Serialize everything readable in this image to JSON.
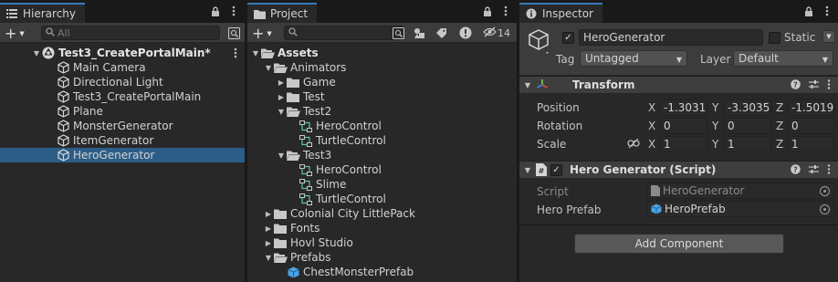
{
  "hierarchy": {
    "tab_label": "Hierarchy",
    "search_placeholder": "All",
    "scene_name": "Test3_CreatePortalMain*",
    "items": [
      {
        "label": "Main Camera"
      },
      {
        "label": "Directional Light"
      },
      {
        "label": "Test3_CreatePortalMain"
      },
      {
        "label": "Plane"
      },
      {
        "label": "MonsterGenerator"
      },
      {
        "label": "ItemGenerator"
      },
      {
        "label": "HeroGenerator",
        "selected": true
      }
    ]
  },
  "project": {
    "tab_label": "Project",
    "search_value": "",
    "hidden_count": "14",
    "tree": [
      {
        "label": "Assets",
        "depth": 0,
        "type": "folder-open",
        "expanded": true,
        "bold": true
      },
      {
        "label": "Animators",
        "depth": 1,
        "type": "folder-open",
        "expanded": true
      },
      {
        "label": "Game",
        "depth": 2,
        "type": "folder",
        "expanded": false
      },
      {
        "label": "Test",
        "depth": 2,
        "type": "folder",
        "expanded": false
      },
      {
        "label": "Test2",
        "depth": 2,
        "type": "folder-open",
        "expanded": true
      },
      {
        "label": "HeroControl",
        "depth": 3,
        "type": "animator"
      },
      {
        "label": "TurtleControl",
        "depth": 3,
        "type": "animator"
      },
      {
        "label": "Test3",
        "depth": 2,
        "type": "folder-open",
        "expanded": true
      },
      {
        "label": "HeroControl",
        "depth": 3,
        "type": "animator"
      },
      {
        "label": "Slime",
        "depth": 3,
        "type": "animator"
      },
      {
        "label": "TurtleControl",
        "depth": 3,
        "type": "animator"
      },
      {
        "label": "Colonial City LittlePack",
        "depth": 1,
        "type": "folder",
        "expanded": false
      },
      {
        "label": "Fonts",
        "depth": 1,
        "type": "folder",
        "expanded": false
      },
      {
        "label": "Hovl Studio",
        "depth": 1,
        "type": "folder",
        "expanded": false
      },
      {
        "label": "Prefabs",
        "depth": 1,
        "type": "folder-open",
        "expanded": true
      },
      {
        "label": "ChestMonsterPrefab",
        "depth": 2,
        "type": "prefab"
      }
    ]
  },
  "inspector": {
    "tab_label": "Inspector",
    "object_name": "HeroGenerator",
    "active": true,
    "static_label": "Static",
    "tag_label": "Tag",
    "tag_value": "Untagged",
    "layer_label": "Layer",
    "layer_value": "Default",
    "transform": {
      "title": "Transform",
      "position_label": "Position",
      "rotation_label": "Rotation",
      "scale_label": "Scale",
      "position": {
        "x": "-1.3031",
        "y": "-3.3035",
        "z": "-1.5019"
      },
      "rotation": {
        "x": "0",
        "y": "0",
        "z": "0"
      },
      "scale": {
        "x": "1",
        "y": "1",
        "z": "1"
      },
      "axis_x": "X",
      "axis_y": "Y",
      "axis_z": "Z"
    },
    "script_component": {
      "title": "Hero Generator (Script)",
      "enabled": true,
      "script_label": "Script",
      "script_value": "HeroGenerator",
      "hero_prefab_label": "Hero Prefab",
      "hero_prefab_value": "HeroPrefab"
    },
    "add_component_label": "Add Component"
  },
  "colors": {
    "selection": "#2c5d87",
    "tab_accent": "#3a79bb",
    "panel_bg": "#282828",
    "toolbar_bg": "#3c3c3c"
  }
}
